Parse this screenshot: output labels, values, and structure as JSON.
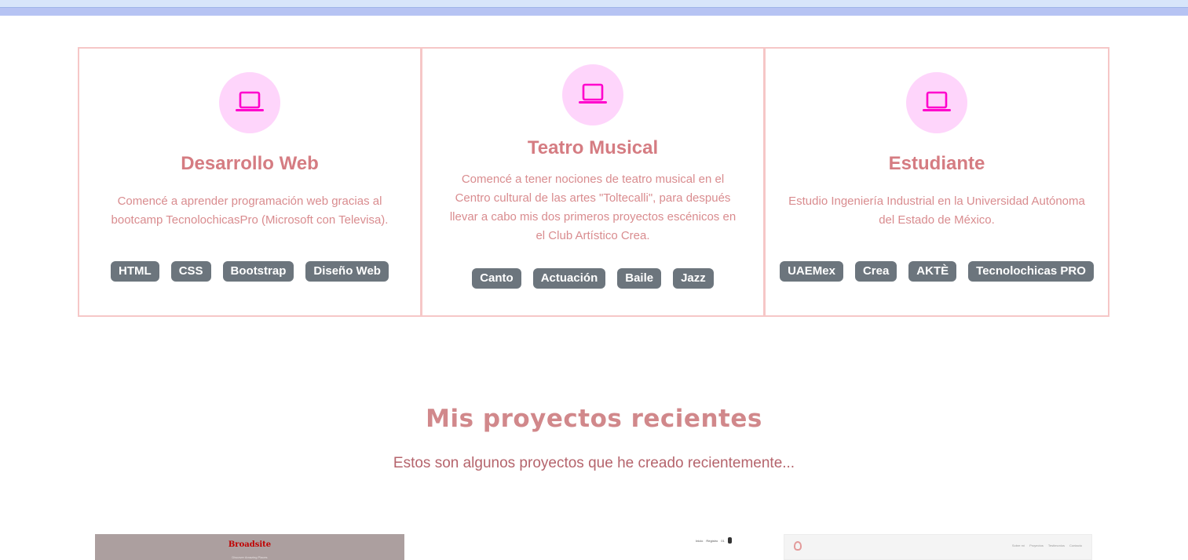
{
  "cards": [
    {
      "title": "Desarrollo Web",
      "text": "Comencé a aprender programación web gracias al bootcamp TecnolochicasPro (Microsoft con Televisa).",
      "badges": [
        "HTML",
        "CSS",
        "Bootstrap",
        "Diseño Web"
      ],
      "icon": "laptop-icon"
    },
    {
      "title": "Teatro Musical",
      "text": "Comencé a tener nociones de teatro musical en el Centro cultural de las artes \"Toltecalli\", para después llevar a cabo mis dos primeros proyectos escénicos en el Club Artístico Crea.",
      "badges": [
        "Canto",
        "Actuación",
        "Baile",
        "Jazz"
      ],
      "icon": "laptop-icon"
    },
    {
      "title": "Estudiante",
      "text": "Estudio Ingeniería Industrial en la Universidad Autónoma del Estado de México.",
      "badges": [
        "UAEMex",
        "Crea",
        "AKTÈ",
        "Tecnolochicas PRO"
      ],
      "icon": "laptop-icon"
    }
  ],
  "projects_section": {
    "title": "Mis proyectos recientes",
    "subtitle": "Estos son algunos proyectos que he creado recientemente..."
  },
  "project_thumbs": [
    {
      "title": "Broadsite",
      "subtitle": "Discover Amazing Places"
    },
    {
      "nav": [
        "Inicio",
        "Registro",
        "01"
      ]
    },
    {
      "nav": [
        "Sobre mí",
        "Proyectos",
        "Testimonios",
        "Contacto"
      ]
    }
  ],
  "colors": {
    "accent": "#d57c82",
    "border": "#f6c7c7",
    "icon_bg": "#fed5fb",
    "icon_fg": "#ff00cc",
    "badge_bg": "#6c757d"
  }
}
